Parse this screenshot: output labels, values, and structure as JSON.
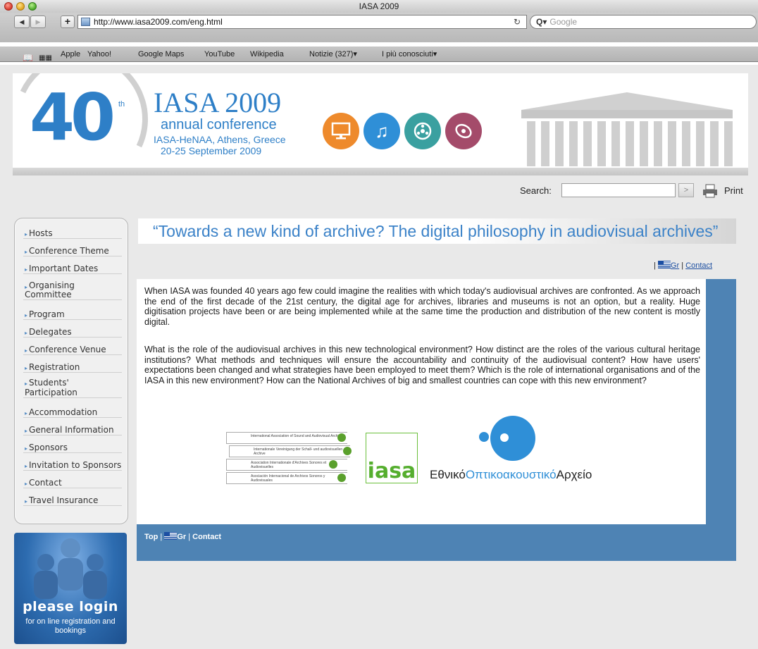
{
  "browser": {
    "window_title": "IASA 2009",
    "url": "http://www.iasa2009.com/eng.html",
    "search_placeholder": "Google",
    "bookmarks": [
      "Apple",
      "Yahoo!",
      "Google Maps",
      "YouTube",
      "Wikipedia",
      "Notizie (327)▾",
      "I più conosciuti▾"
    ]
  },
  "banner": {
    "number": "40",
    "superscript": "th",
    "title": "IASA 2009",
    "subtitle": "annual conference",
    "location": "IASA-HeNAA, Athens, Greece",
    "dates": "20-25 September 2009"
  },
  "search": {
    "label": "Search:",
    "value": "",
    "print_label": "Print"
  },
  "menu": {
    "items": [
      {
        "label": "Hosts"
      },
      {
        "label": "Conference Theme"
      },
      {
        "label": "Important Dates"
      },
      {
        "label": "Organising\nCommittee"
      },
      {
        "label": "Program"
      },
      {
        "label": "Delegates"
      },
      {
        "label": "Conference Venue"
      },
      {
        "label": "Registration"
      },
      {
        "label": "Students'\nParticipation"
      },
      {
        "label": "Accommodation"
      },
      {
        "label": "General Information"
      },
      {
        "label": "Sponsors"
      },
      {
        "label": "Invitation to Sponsors"
      },
      {
        "label": "Contact"
      },
      {
        "label": "Travel Insurance"
      }
    ]
  },
  "login": {
    "title": "please login",
    "subtitle": "for on line registration and bookings"
  },
  "main": {
    "headline": "“Towards a new kind of archive? The digital philosophy in audiovisual archives”",
    "lang_gr": "Gr",
    "contact": "Contact",
    "paragraph1": "When IASA was founded 40 years ago few could imagine the realities with which today's audiovisual archives are confronted.  As we approach the end of the first decade of the 21st century, the digital age for archives, libraries and museums is not an option, but a reality.  Huge digitisation projects have been or are being implemented while at the same time the production and distribution of the new content is mostly digital.",
    "paragraph2": "What is the role of the audiovisual archives in this new technological environment? How distinct are the roles of the various cultural heritage institutions? What methods and techniques will ensure the accountability and continuity of the audiovisual content? How have users' expectations been changed and what strategies have been employed to meet them? Which is the role of international organisations and of the IASA in this new environment?  How can the National Archives of big and smallest countries can cope with this new environment?"
  },
  "partners": {
    "multilingual_rows": [
      "International Association of Sound and Audiovisual Archives",
      "Internationale Vereinigung der Schall- und audiovisuellen Archive",
      "Association Internationale d'Archives Sonores et Audiovisuelles",
      "Asociación Internacional de Archivos Sonoros y Audiovisuales"
    ],
    "iasa_logo_text": "iasa",
    "eoa_part1": "Εθνικό",
    "eoa_part2": "Οπτικοακουστικό",
    "eoa_part3": "Αρχείο"
  },
  "footer": {
    "top": "Top",
    "gr": "Gr",
    "contact": "Contact"
  },
  "colors": {
    "brand_blue": "#3b82c8",
    "frame_blue": "#4e83b4",
    "iasa_green": "#55ae2e"
  }
}
